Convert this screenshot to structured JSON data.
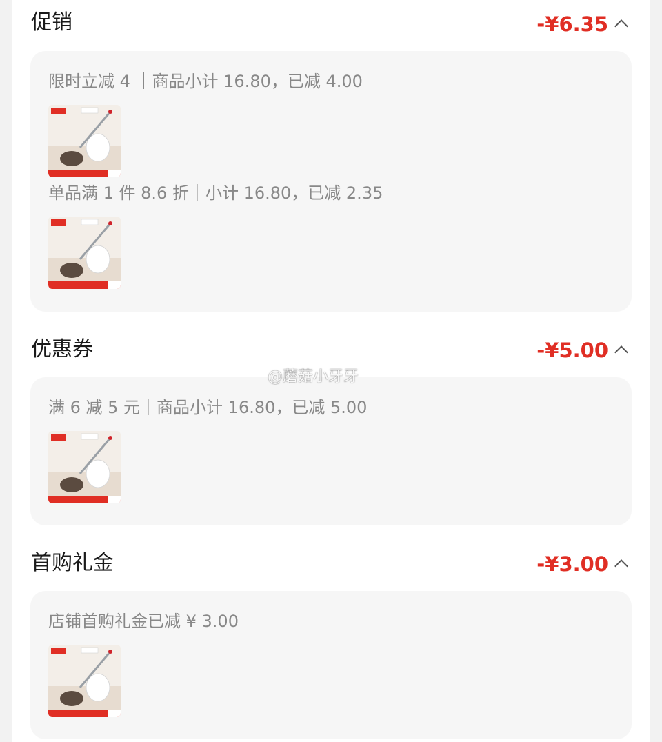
{
  "sections": [
    {
      "title": "促销",
      "amount": "-¥6.35",
      "rules": [
        {
          "text": "限时立减 4 ｜商品小计 16.80，已减 4.00",
          "product": "toilet-brush-product"
        },
        {
          "text": "单品满 1 件 8.6 折｜小计 16.80，已减 2.35",
          "product": "toilet-brush-product"
        }
      ]
    },
    {
      "title": "优惠券",
      "amount": "-¥5.00",
      "rules": [
        {
          "text": "满 6 减 5 元｜商品小计 16.80，已减 5.00",
          "product": "toilet-brush-product"
        }
      ]
    },
    {
      "title": "首购礼金",
      "amount": "-¥3.00",
      "rules": [
        {
          "text": "店铺首购礼金已减 ¥ 3.00",
          "product": "toilet-brush-product"
        }
      ]
    }
  ],
  "watermark": "@蘑菇小牙牙",
  "colors": {
    "accent": "#e02e24",
    "panel": "#f6f6f6",
    "muted": "#888888"
  }
}
